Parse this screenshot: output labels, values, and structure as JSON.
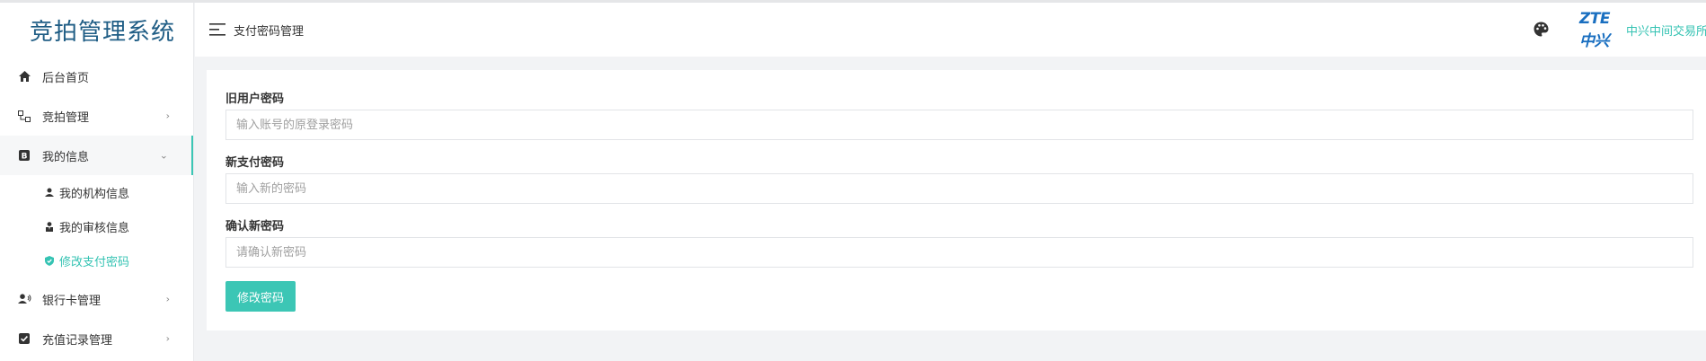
{
  "app": {
    "title": "竞拍管理系统"
  },
  "header": {
    "page_title": "支付密码管理",
    "logo_brand": "ZTE中兴",
    "logo_text": "中兴中间交易所"
  },
  "sidebar": {
    "items": [
      {
        "label": "后台首页",
        "icon": "home-icon"
      },
      {
        "label": "竞拍管理",
        "icon": "sitemap-icon"
      },
      {
        "label": "我的信息",
        "icon": "bold-b-icon"
      },
      {
        "label": "银行卡管理",
        "icon": "user-card-icon"
      },
      {
        "label": "充值记录管理",
        "icon": "check-square-icon"
      }
    ],
    "sub_items": [
      {
        "label": "我的机构信息",
        "icon": "user-icon"
      },
      {
        "label": "我的审核信息",
        "icon": "user-tie-icon"
      },
      {
        "label": "修改支付密码",
        "icon": "shield-check-icon"
      }
    ]
  },
  "form": {
    "old_password_label": "旧用户密码",
    "old_password_placeholder": "输入账号的原登录密码",
    "new_password_label": "新支付密码",
    "new_password_placeholder": "输入新的密码",
    "confirm_password_label": "确认新密码",
    "confirm_password_placeholder": "请确认新密码",
    "submit_label": "修改密码"
  },
  "colors": {
    "accent": "#3cc6b5",
    "brand_title": "#1f5d85",
    "background": "#f2f3f5"
  }
}
